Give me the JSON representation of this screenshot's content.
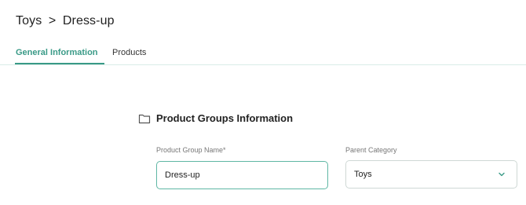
{
  "breadcrumb": {
    "parent": "Toys",
    "separator": ">",
    "current": "Dress-up"
  },
  "tabs": [
    {
      "label": "General Information",
      "active": true
    },
    {
      "label": "Products",
      "active": false
    }
  ],
  "section": {
    "title": "Product Groups Information",
    "icon": "folder-icon"
  },
  "form": {
    "product_group_name": {
      "label": "Product Group Name*",
      "value": "Dress-up"
    },
    "parent_category": {
      "label": "Parent Category",
      "value": "Toys"
    }
  },
  "colors": {
    "accent": "#3a9a87",
    "input_focus_border": "#5fb7a4",
    "chevron": "#3a9a87"
  }
}
